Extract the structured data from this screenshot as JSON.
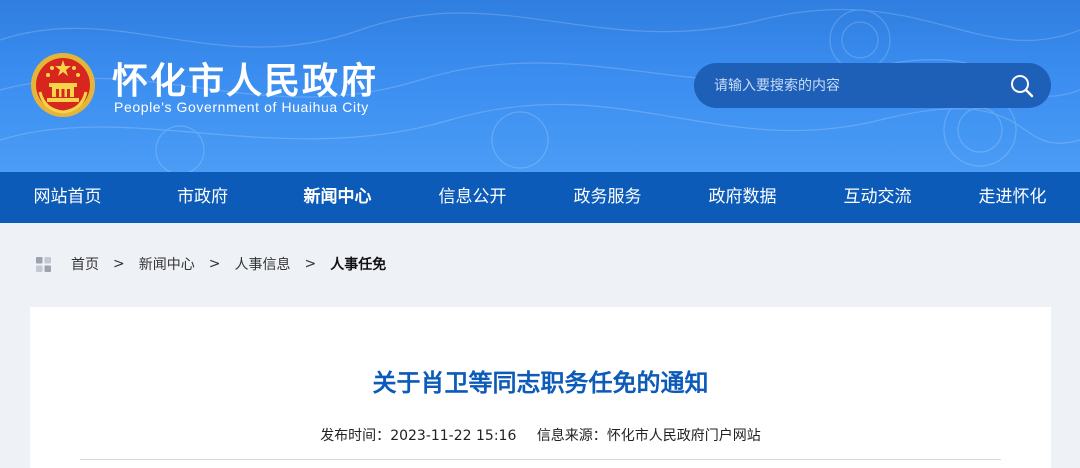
{
  "header": {
    "title": "怀化市人民政府",
    "subtitle": "People's Government of Huaihua City",
    "search": {
      "placeholder": "请输入要搜索的内容"
    }
  },
  "nav": {
    "items": [
      {
        "label": "网站首页"
      },
      {
        "label": "市政府"
      },
      {
        "label": "新闻中心",
        "active": true
      },
      {
        "label": "信息公开"
      },
      {
        "label": "政务服务"
      },
      {
        "label": "政府数据"
      },
      {
        "label": "互动交流"
      },
      {
        "label": "走进怀化"
      }
    ]
  },
  "breadcrumb": {
    "items": [
      "首页",
      "新闻中心",
      "人事信息"
    ],
    "separator": ">",
    "current": "人事任免"
  },
  "article": {
    "title": "关于肖卫等同志职务任免的通知",
    "publish_label": "发布时间：",
    "publish_time": "2023-11-22 15:16",
    "source_label": "信息来源：",
    "source": "怀化市人民政府门户网站"
  },
  "colors": {
    "header_blue": "#3b8ef0",
    "nav_blue": "#0c5bb8",
    "title_blue": "#0c5bb8"
  },
  "icons": [
    "emblem-icon",
    "search-icon",
    "grid-icon"
  ]
}
